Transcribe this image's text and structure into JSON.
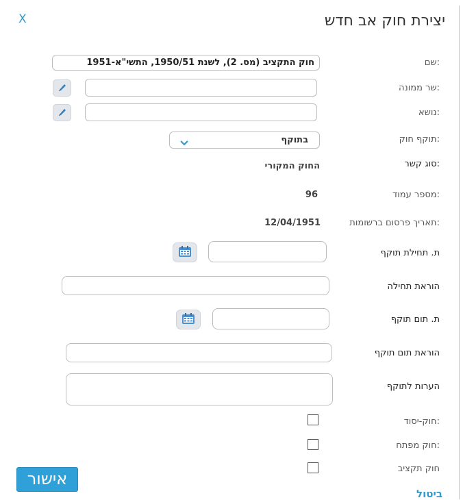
{
  "dialog": {
    "title": "יצירת חוק אב חדש",
    "close_label": "X"
  },
  "fields": {
    "name": {
      "label": "שם:",
      "value": "חוק התקציב (מס. 2), לשנת 1950/51, התשי\"א-1951"
    },
    "minister": {
      "label": "שר ממונה:",
      "value": ""
    },
    "subject": {
      "label": "נושא:",
      "value": ""
    },
    "validity": {
      "label": "תוקף חוק:",
      "selected": "בתוקף"
    },
    "link_type": {
      "label": "סוג קשר:",
      "value": "החוק המקורי"
    },
    "page_number": {
      "label": "מספר עמוד:",
      "value": "96"
    },
    "publication_date": {
      "label": "תאריך פרסום ברשומות:",
      "value": "12/04/1951"
    },
    "start_date": {
      "label": "ת. תחילת תוקף",
      "value": ""
    },
    "start_provision": {
      "label": "הוראת תחילה",
      "value": ""
    },
    "end_date": {
      "label": "ת. תום תוקף",
      "value": ""
    },
    "end_provision": {
      "label": "הוראת תום תוקף",
      "value": ""
    },
    "validity_notes": {
      "label": "הערות לתוקף",
      "value": ""
    },
    "basic_law": {
      "label": "חוק-יסוד:",
      "checked": false
    },
    "key_law": {
      "label": "חוק מפתח:",
      "checked": false
    },
    "budget_law": {
      "label": "חוק תקציב",
      "checked": false
    }
  },
  "actions": {
    "ok_label": "אישור",
    "cancel_label": "ביטול"
  },
  "colors": {
    "accent": "#3399cc",
    "button": "#2fa0d8"
  }
}
